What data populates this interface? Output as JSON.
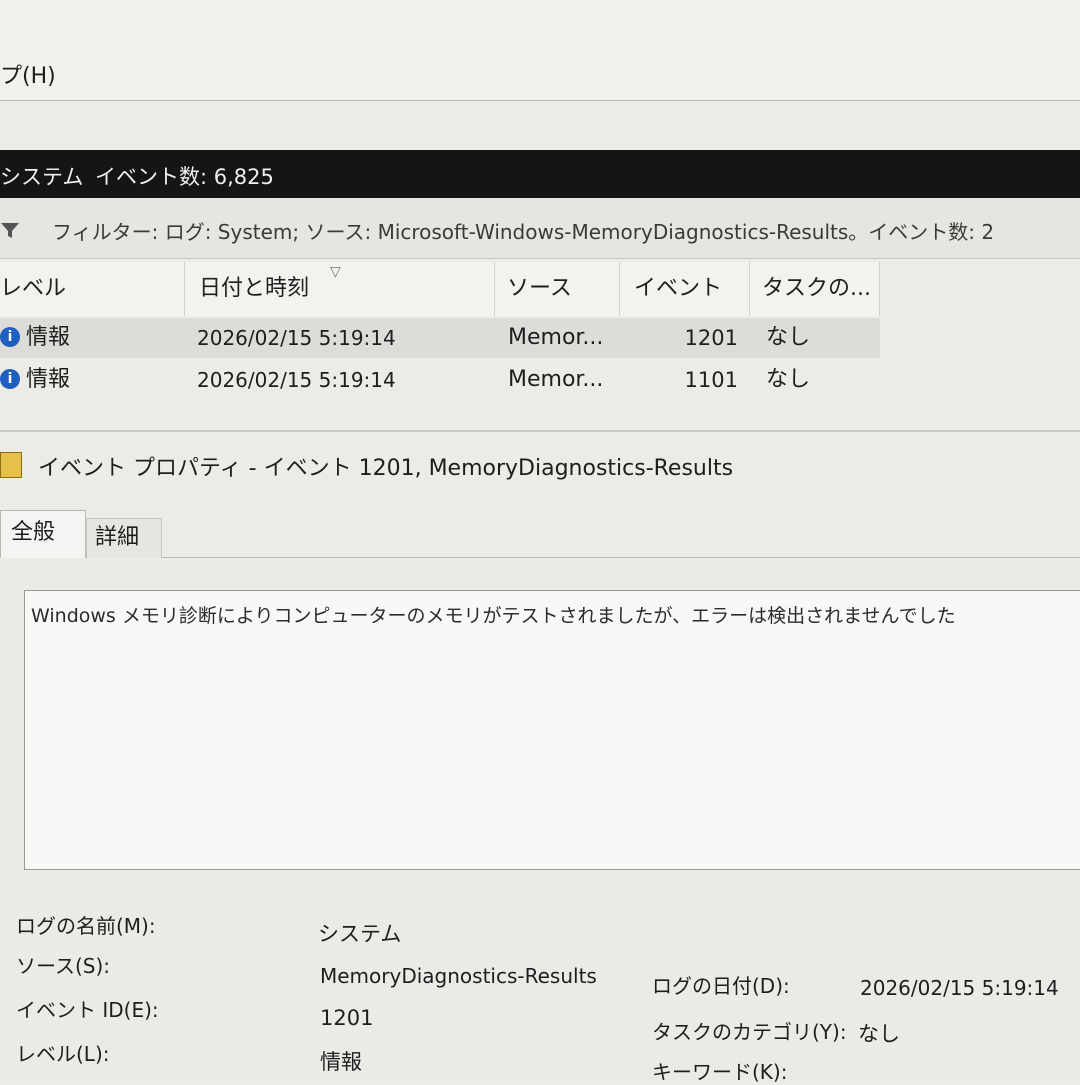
{
  "menu": {
    "help": "プ(H)"
  },
  "log_header": {
    "name": "システム",
    "event_count": "イベント数: 6,825"
  },
  "filter": {
    "text": "フィルター: ログ: System; ソース: Microsoft-Windows-MemoryDiagnostics-Results。イベント数: 2"
  },
  "grid": {
    "columns": [
      "レベル",
      "日付と時刻",
      "ソース",
      "イベント ...",
      "タスクの..."
    ],
    "rows": [
      {
        "level": "情報",
        "date": "2026/02/15 5:19:14",
        "source": "Memor...",
        "event_id": "1201",
        "task": "なし"
      },
      {
        "level": "情報",
        "date": "2026/02/15 5:19:14",
        "source": "Memor...",
        "event_id": "1101",
        "task": "なし"
      }
    ]
  },
  "properties": {
    "title": "イベント プロパティ - イベント 1201, MemoryDiagnostics-Results",
    "tabs": [
      "全般",
      "詳細"
    ],
    "description": "Windows メモリ診断によりコンピューターのメモリがテストされましたが、エラーは検出されませんでした",
    "fields": {
      "log_name_label": "ログの名前(M):",
      "log_name_value": "システム",
      "source_label": "ソース(S):",
      "source_value": "MemoryDiagnostics-Results",
      "log_date_label": "ログの日付(D):",
      "log_date_value": "2026/02/15 5:19:14",
      "event_id_label": "イベント ID(E):",
      "event_id_value": "1201",
      "task_category_label": "タスクのカテゴリ(Y):",
      "task_category_value": "なし",
      "level_label": "レベル(L):",
      "level_value": "情報",
      "keyword_label": "キーワード(K):"
    }
  }
}
